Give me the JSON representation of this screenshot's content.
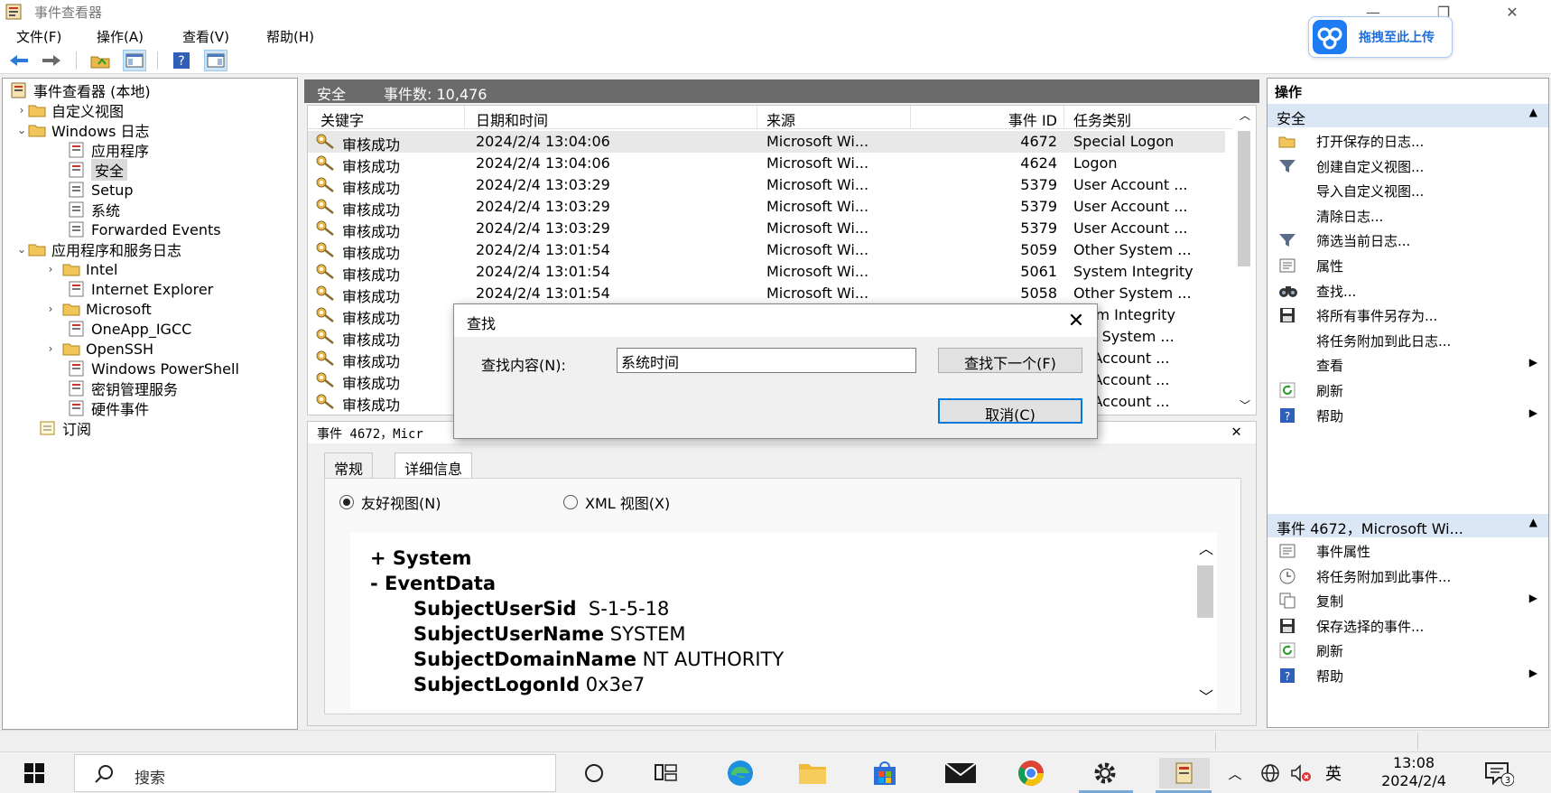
{
  "window": {
    "title": "事件查看器",
    "minimize": "—",
    "restore": "❐",
    "close": "✕"
  },
  "menu": [
    "文件(F)",
    "操作(A)",
    "查看(V)",
    "帮助(H)"
  ],
  "upload_badge": {
    "label": "拖拽至此上传"
  },
  "tree": {
    "root": "事件查看器 (本地)",
    "custom_views": "自定义视图",
    "windows_logs": "Windows 日志",
    "win_items": [
      "应用程序",
      "安全",
      "Setup",
      "系统",
      "Forwarded Events"
    ],
    "app_services": "应用程序和服务日志",
    "app_items": [
      "Intel",
      "Internet Explorer",
      "Microsoft",
      "OneApp_IGCC",
      "OpenSSH",
      "Windows PowerShell",
      "密钥管理服务",
      "硬件事件"
    ],
    "subscriptions": "订阅"
  },
  "center": {
    "log_name": "安全",
    "event_count": "事件数: 10,476"
  },
  "columns": [
    "关键字",
    "日期和时间",
    "来源",
    "事件 ID",
    "任务类别"
  ],
  "events": [
    {
      "kw": "审核成功",
      "dt": "2024/2/4 13:04:06",
      "src": "Microsoft Wi...",
      "id": "4672",
      "cat": "Special Logon"
    },
    {
      "kw": "审核成功",
      "dt": "2024/2/4 13:04:06",
      "src": "Microsoft Wi...",
      "id": "4624",
      "cat": "Logon"
    },
    {
      "kw": "审核成功",
      "dt": "2024/2/4 13:03:29",
      "src": "Microsoft Wi...",
      "id": "5379",
      "cat": "User Account ..."
    },
    {
      "kw": "审核成功",
      "dt": "2024/2/4 13:03:29",
      "src": "Microsoft Wi...",
      "id": "5379",
      "cat": "User Account ..."
    },
    {
      "kw": "审核成功",
      "dt": "2024/2/4 13:03:29",
      "src": "Microsoft Wi...",
      "id": "5379",
      "cat": "User Account ..."
    },
    {
      "kw": "审核成功",
      "dt": "2024/2/4 13:01:54",
      "src": "Microsoft Wi...",
      "id": "5059",
      "cat": "Other System ..."
    },
    {
      "kw": "审核成功",
      "dt": "2024/2/4 13:01:54",
      "src": "Microsoft Wi...",
      "id": "5061",
      "cat": "System Integrity"
    },
    {
      "kw": "审核成功",
      "dt": "2024/2/4 13:01:54",
      "src": "Microsoft Wi...",
      "id": "5058",
      "cat": "Other System ..."
    },
    {
      "kw": "审核成功",
      "dt": "",
      "src": "",
      "id": "",
      "cat": "stem Integrity"
    },
    {
      "kw": "审核成功",
      "dt": "",
      "src": "",
      "id": "",
      "cat": "her System ..."
    },
    {
      "kw": "审核成功",
      "dt": "",
      "src": "",
      "id": "",
      "cat": "er Account ..."
    },
    {
      "kw": "审核成功",
      "dt": "",
      "src": "",
      "id": "",
      "cat": "er Account ..."
    },
    {
      "kw": "审核成功",
      "dt": "",
      "src": "",
      "id": "",
      "cat": "er Account ..."
    }
  ],
  "details": {
    "title": "事件 4672，Micr",
    "tabs": [
      "常规",
      "详细信息"
    ],
    "radio_friendly": "友好视图(N)",
    "radio_xml": "XML 视图(X)",
    "system_label": "+ System",
    "eventdata_label": "- EventData",
    "fields": [
      {
        "k": "SubjectUserSid",
        "v": "S-1-5-18"
      },
      {
        "k": "SubjectUserName",
        "v": "SYSTEM"
      },
      {
        "k": "SubjectDomainName",
        "v": "NT AUTHORITY"
      },
      {
        "k": "SubjectLogonId",
        "v": "0x3e7"
      }
    ]
  },
  "actions": {
    "title": "操作",
    "section1": "安全",
    "items1": [
      {
        "label": "打开保存的日志...",
        "icon": "folder-open-icon",
        "sub": false
      },
      {
        "label": "创建自定义视图...",
        "icon": "filter-icon",
        "sub": false
      },
      {
        "label": "导入自定义视图...",
        "icon": "",
        "sub": false
      },
      {
        "label": "清除日志...",
        "icon": "",
        "sub": false
      },
      {
        "label": "筛选当前日志...",
        "icon": "filter-icon",
        "sub": false
      },
      {
        "label": "属性",
        "icon": "properties-icon",
        "sub": false
      },
      {
        "label": "查找...",
        "icon": "binoculars-icon",
        "sub": false
      },
      {
        "label": "将所有事件另存为...",
        "icon": "save-icon",
        "sub": false
      },
      {
        "label": "将任务附加到此日志...",
        "icon": "",
        "sub": false
      },
      {
        "label": "查看",
        "icon": "",
        "sub": true
      },
      {
        "label": "刷新",
        "icon": "refresh-icon",
        "sub": false
      },
      {
        "label": "帮助",
        "icon": "help-icon",
        "sub": true
      }
    ],
    "section2": "事件 4672，Microsoft Wi...",
    "items2": [
      {
        "label": "事件属性",
        "icon": "properties-icon",
        "sub": false
      },
      {
        "label": "将任务附加到此事件...",
        "icon": "task-icon",
        "sub": false
      },
      {
        "label": "复制",
        "icon": "copy-icon",
        "sub": true
      },
      {
        "label": "保存选择的事件...",
        "icon": "save-icon",
        "sub": false
      },
      {
        "label": "刷新",
        "icon": "refresh-icon",
        "sub": false
      },
      {
        "label": "帮助",
        "icon": "help-icon",
        "sub": true
      }
    ]
  },
  "find_dialog": {
    "title": "查找",
    "label": "查找内容(N):",
    "value": "系统时间",
    "find_next": "查找下一个(F)",
    "cancel": "取消(C)"
  },
  "taskbar": {
    "search_placeholder": "搜索",
    "ime": "英",
    "time": "13:08",
    "date": "2024/2/4",
    "notification_count": "3"
  },
  "colors": {
    "accent": "#0078d7",
    "header_gray": "#6b6b6b",
    "section_blue": "#dbe7f5"
  }
}
